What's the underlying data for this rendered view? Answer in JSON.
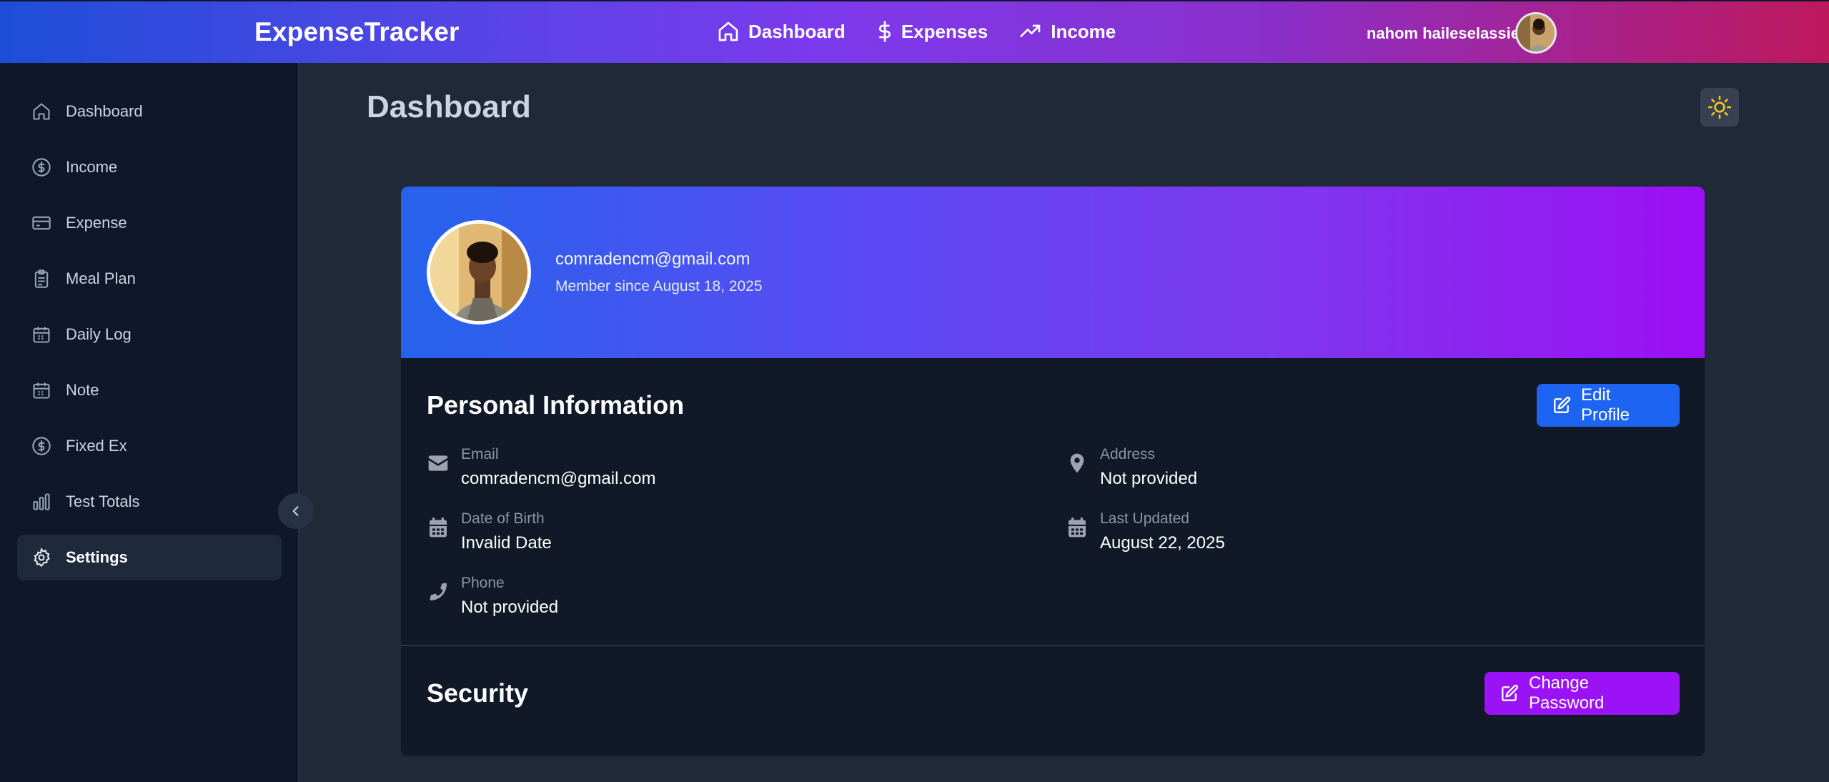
{
  "header": {
    "brand": "ExpenseTracker",
    "nav": [
      {
        "label": "Dashboard",
        "icon": "home-icon"
      },
      {
        "label": "Expenses",
        "icon": "dollar-icon"
      },
      {
        "label": "Income",
        "icon": "trending-up-icon"
      }
    ],
    "user_name": "nahom haileselassie"
  },
  "sidebar": {
    "items": [
      {
        "label": "Dashboard",
        "icon": "home-icon"
      },
      {
        "label": "Income",
        "icon": "dollar-circle-icon"
      },
      {
        "label": "Expense",
        "icon": "credit-card-icon"
      },
      {
        "label": "Meal Plan",
        "icon": "clipboard-icon"
      },
      {
        "label": "Daily Log",
        "icon": "calendar-icon"
      },
      {
        "label": "Note",
        "icon": "calendar-icon"
      },
      {
        "label": "Fixed Ex",
        "icon": "dollar-circle-icon"
      },
      {
        "label": "Test Totals",
        "icon": "bar-chart-icon"
      },
      {
        "label": "Settings",
        "icon": "gear-icon",
        "active": true
      }
    ]
  },
  "main": {
    "title": "Dashboard",
    "profile": {
      "email": "comradencm@gmail.com",
      "member_since": "Member since August 18, 2025"
    },
    "personal_info": {
      "title": "Personal Information",
      "edit_label": "Edit Profile",
      "fields": {
        "email": {
          "label": "Email",
          "value": "comradencm@gmail.com"
        },
        "dob": {
          "label": "Date of Birth",
          "value": "Invalid Date"
        },
        "phone": {
          "label": "Phone",
          "value": "Not provided"
        },
        "address": {
          "label": "Address",
          "value": "Not provided"
        },
        "updated": {
          "label": "Last Updated",
          "value": "August 22, 2025"
        }
      }
    },
    "security": {
      "title": "Security",
      "change_password_label": "Change Password"
    }
  },
  "colors": {
    "accent_blue": "#1d64f2",
    "accent_purple": "#9a12f5",
    "sidebar_bg": "#0f172a",
    "main_bg": "#1f2937"
  }
}
